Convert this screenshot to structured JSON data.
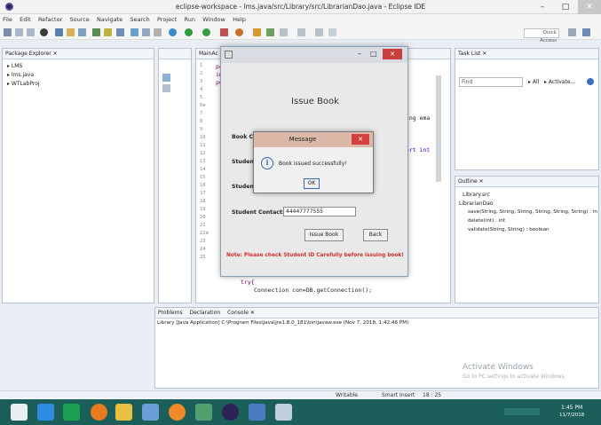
{
  "window": {
    "title": "eclipse-workspace - lms.java/src/Library/src/LibrarianDao.java - Eclipse IDE",
    "minimize": "–",
    "maximize": "□",
    "close": "✕"
  },
  "menu": [
    "File",
    "Edit",
    "Refactor",
    "Source",
    "Navigate",
    "Search",
    "Project",
    "Run",
    "Window",
    "Help"
  ],
  "toolbar": {
    "quick_access": "Quick Access"
  },
  "package_explorer": {
    "title": "Package Explorer ✕",
    "items": [
      "LMS",
      "lms.java",
      "WTLabProj"
    ]
  },
  "editor": {
    "tab": "MainAc",
    "lines": [
      "1",
      "2",
      "3",
      "4",
      "5",
      "6⊕",
      "7",
      "8",
      "9",
      "10",
      "11",
      "12",
      "13",
      "14",
      "15",
      "16",
      "17",
      "18",
      "19",
      "20",
      "21",
      "22⊕",
      "23",
      "24",
      "25"
    ],
    "code": [
      {
        "line": 1,
        "text": "pac"
      },
      {
        "line": 2,
        "text": "imp"
      },
      {
        "line": 3,
        "text": "pub"
      },
      {
        "line": 6,
        "text": "ring ema"
      },
      {
        "line": 9,
        "text": "sert int"
      },
      {
        "line": 24,
        "text": "try{"
      },
      {
        "line": 25,
        "text": "Connection con=DB.getConnection();"
      }
    ]
  },
  "task_list": {
    "title": "Task List ✕",
    "find_placeholder": "Find",
    "all": "All",
    "activate": "Activate..."
  },
  "outline": {
    "title": "Outline ✕",
    "items": [
      "Library.src",
      "LibrarianDao",
      "save(String, String, String, String, String, String) : in",
      "delete(int) : int",
      "validate(String, String) : boolean"
    ]
  },
  "console": {
    "tabs": [
      "Problems",
      "Declaration",
      "Console ✕"
    ],
    "text": "Library [Java Application] C:\\Program Files\\Java\\jre1.8.0_181\\bin\\javaw.exe (Nov 7, 2018, 1:42:46 PM)"
  },
  "issue_dialog": {
    "heading": "Issue Book",
    "labels": [
      "Book Calli",
      "Student Id",
      "Student N",
      "Student Contact:"
    ],
    "contact_value": "44447777555",
    "issue_button": "Issue Book",
    "back_button": "Back",
    "note": "Note: Please check Student ID Carefully before issuing book!"
  },
  "message_dialog": {
    "title": "Message",
    "text": "Book issued successfully!",
    "ok": "OK",
    "info_icon": "i"
  },
  "status_bar": {
    "writable": "Writable",
    "insert": "Smart Insert",
    "position": "18 : 25"
  },
  "watermark": {
    "line1": "Activate Windows",
    "line2": "Go to PC settings to activate Windows."
  },
  "taskbar": {
    "time": "1:45 PM",
    "date": "11/7/2018"
  }
}
